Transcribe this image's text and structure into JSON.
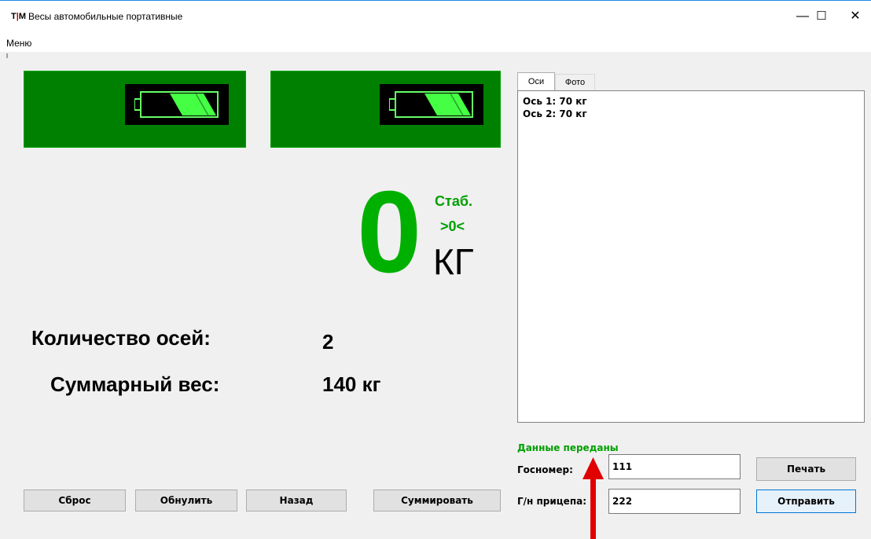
{
  "window": {
    "logo": {
      "left": "T",
      "sep": "|",
      "right": "M"
    },
    "title": "Весы автомобильные портативные",
    "minimize_icon": "—",
    "maximize_icon": "☐",
    "close_icon": "✕"
  },
  "menu": {
    "items": [
      "Меню"
    ]
  },
  "scale_panels": [
    {
      "icon": "battery-icon",
      "charge_fraction": 0.66
    },
    {
      "icon": "battery-icon",
      "charge_fraction": 0.66
    }
  ],
  "weight": {
    "value": "0",
    "stable": "Стаб.",
    "zero": ">0<",
    "unit": "КГ"
  },
  "summary": {
    "axles_label": "Количество осей:",
    "axles_value": "2",
    "total_label": "Суммарный вес:",
    "total_value": "140 кг"
  },
  "tabs": [
    {
      "label": "Оси",
      "active": true
    },
    {
      "label": "Фото",
      "active": false
    }
  ],
  "axle_list": [
    "Ось  1: 70 кг",
    "Ось  2: 70 кг"
  ],
  "status": "Данные переданы",
  "form": {
    "plate_label": "Госномер:",
    "plate_value": "111",
    "trailer_label": "Г/н прицепа:",
    "trailer_value": "222"
  },
  "buttons": {
    "reset": "Сброс",
    "zero": "Обнулить",
    "back": "Назад",
    "sum": "Суммировать",
    "print": "Печать",
    "send": "Отправить"
  },
  "colors": {
    "panel": "#008000",
    "accent_green": "#00b000",
    "arrow": "#e00000"
  }
}
